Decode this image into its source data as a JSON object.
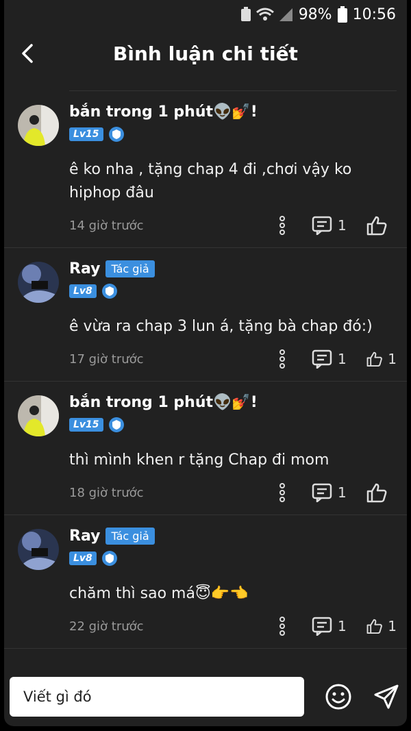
{
  "status": {
    "battery": "98%",
    "time": "10:56"
  },
  "header": {
    "title": "Bình luận chi tiết"
  },
  "comments": [
    {
      "user": "bắn trong 1 phút👽💅!",
      "author_tag": "",
      "level": "Lv15",
      "text": "ê ko nha , tặng chap 4 đi ,chơi vậy ko hiphop đâu",
      "time": "14 giờ trước",
      "replies": "1",
      "likes": ""
    },
    {
      "user": "Ray",
      "author_tag": "Tác giả",
      "level": "Lv8",
      "text": "ê vừa ra chap 3 lun á, tặng bà chap đó:)",
      "time": "17 giờ trước",
      "replies": "1",
      "likes": "1"
    },
    {
      "user": "bắn trong 1 phút👽💅!",
      "author_tag": "",
      "level": "Lv15",
      "text": "thì mình khen r tặng Chap đi mom",
      "time": "18 giờ trước",
      "replies": "1",
      "likes": ""
    },
    {
      "user": "Ray",
      "author_tag": "Tác giả",
      "level": "Lv8",
      "text": "chăm thì sao má😇👉👈",
      "time": "22 giờ trước",
      "replies": "1",
      "likes": "1"
    }
  ],
  "composer": {
    "placeholder": "Viết gì đó"
  },
  "icons": [
    "back-arrow-icon",
    "more-vertical-icon",
    "reply-icon",
    "thumbs-up-icon",
    "emoji-icon",
    "send-icon"
  ]
}
